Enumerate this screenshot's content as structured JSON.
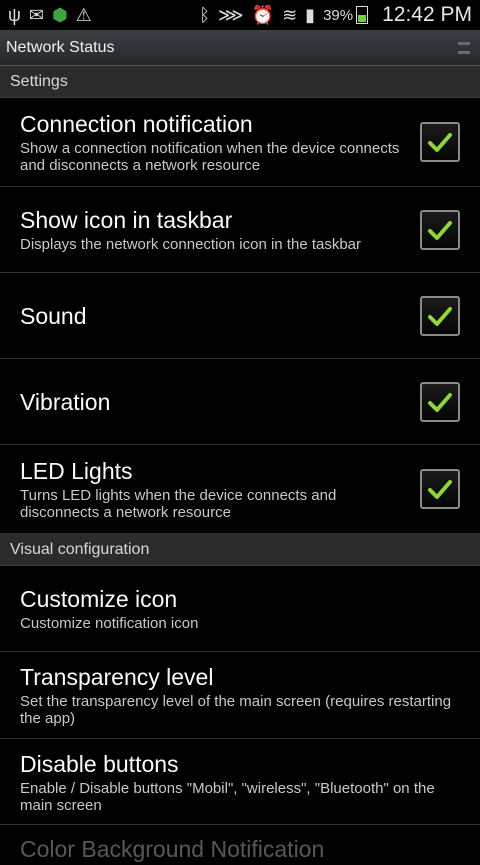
{
  "status_bar": {
    "icons": [
      "usb-icon",
      "gmail-icon",
      "android-icon",
      "warning-icon",
      "bluetooth-icon",
      "nfc-icon",
      "alarm-icon",
      "wifi-icon",
      "signal-icon"
    ],
    "battery": "39%",
    "time": "12:42 PM"
  },
  "app": {
    "title": "Network Status"
  },
  "sections": {
    "settings": "Settings",
    "visual": "Visual configuration"
  },
  "settings_items": [
    {
      "title": "Connection notification",
      "subtitle": "Show a connection notification when the device connects and disconnects a network resource",
      "checked": true
    },
    {
      "title": "Show icon in taskbar",
      "subtitle": "Displays the network connection icon in the taskbar",
      "checked": true
    },
    {
      "title": "Sound",
      "subtitle": "",
      "checked": true
    },
    {
      "title": "Vibration",
      "subtitle": "",
      "checked": true
    },
    {
      "title": "LED Lights",
      "subtitle": "Turns LED lights when the device connects and disconnects a network resource",
      "checked": true
    }
  ],
  "visual_items": [
    {
      "title": "Customize icon",
      "subtitle": "Customize notification icon"
    },
    {
      "title": "Transparency level",
      "subtitle": "Set the transparency level of the main screen (requires restarting the app)"
    },
    {
      "title": "Disable buttons",
      "subtitle": "Enable / Disable buttons \"Mobil\", \"wireless\", \"Bluetooth\" on the main screen"
    },
    {
      "title": "Color Background Notification",
      "subtitle": ""
    }
  ],
  "colors": {
    "check": "#8fd63a",
    "section_bg": "#2b2b2b"
  }
}
